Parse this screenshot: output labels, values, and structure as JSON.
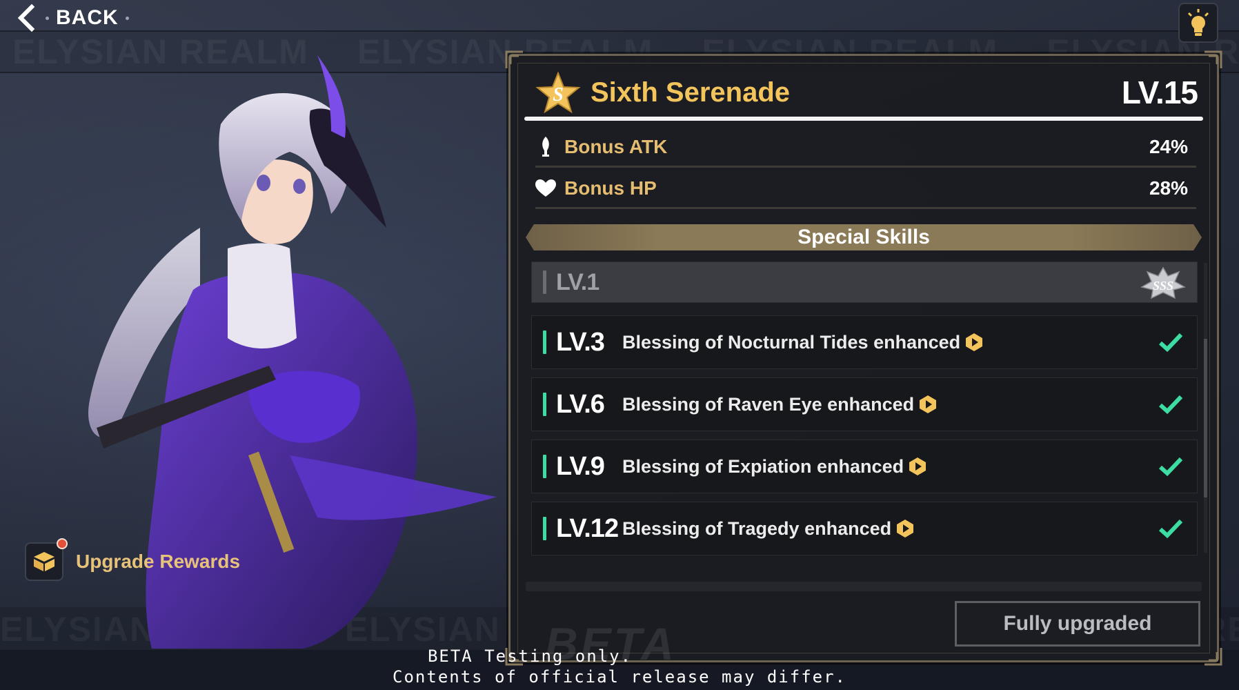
{
  "header": {
    "back_label": "BACK"
  },
  "background": {
    "watermark_text": "ELYSIAN REALM"
  },
  "rewards": {
    "label": "Upgrade Rewards"
  },
  "stigma": {
    "name": "Sixth Serenade",
    "level": "LV.15",
    "stats": [
      {
        "label": "Bonus ATK",
        "value": "24%",
        "icon": "sword-icon"
      },
      {
        "label": "Bonus HP",
        "value": "28%",
        "icon": "heart-icon"
      }
    ]
  },
  "special_skills": {
    "title": "Special Skills",
    "items": [
      {
        "level": "LV.1",
        "desc": "",
        "state": "locked",
        "badge": "SSS"
      },
      {
        "level": "LV.3",
        "desc": "Blessing of Nocturnal Tides enhanced",
        "state": "done"
      },
      {
        "level": "LV.6",
        "desc": "Blessing of Raven Eye enhanced",
        "state": "done"
      },
      {
        "level": "LV.9",
        "desc": "Blessing of Expiation enhanced",
        "state": "done"
      },
      {
        "level": "LV.12",
        "desc": "Blessing of Tragedy enhanced",
        "state": "done"
      }
    ]
  },
  "action": {
    "button_label": "Fully upgraded"
  },
  "beta": {
    "watermark": "BETA",
    "line1": "BETA Testing only.",
    "line2": "Contents of official release may differ."
  },
  "colors": {
    "accent_gold": "#f3c45c",
    "stat_label": "#e5bd71",
    "check_green": "#3ddca3"
  }
}
